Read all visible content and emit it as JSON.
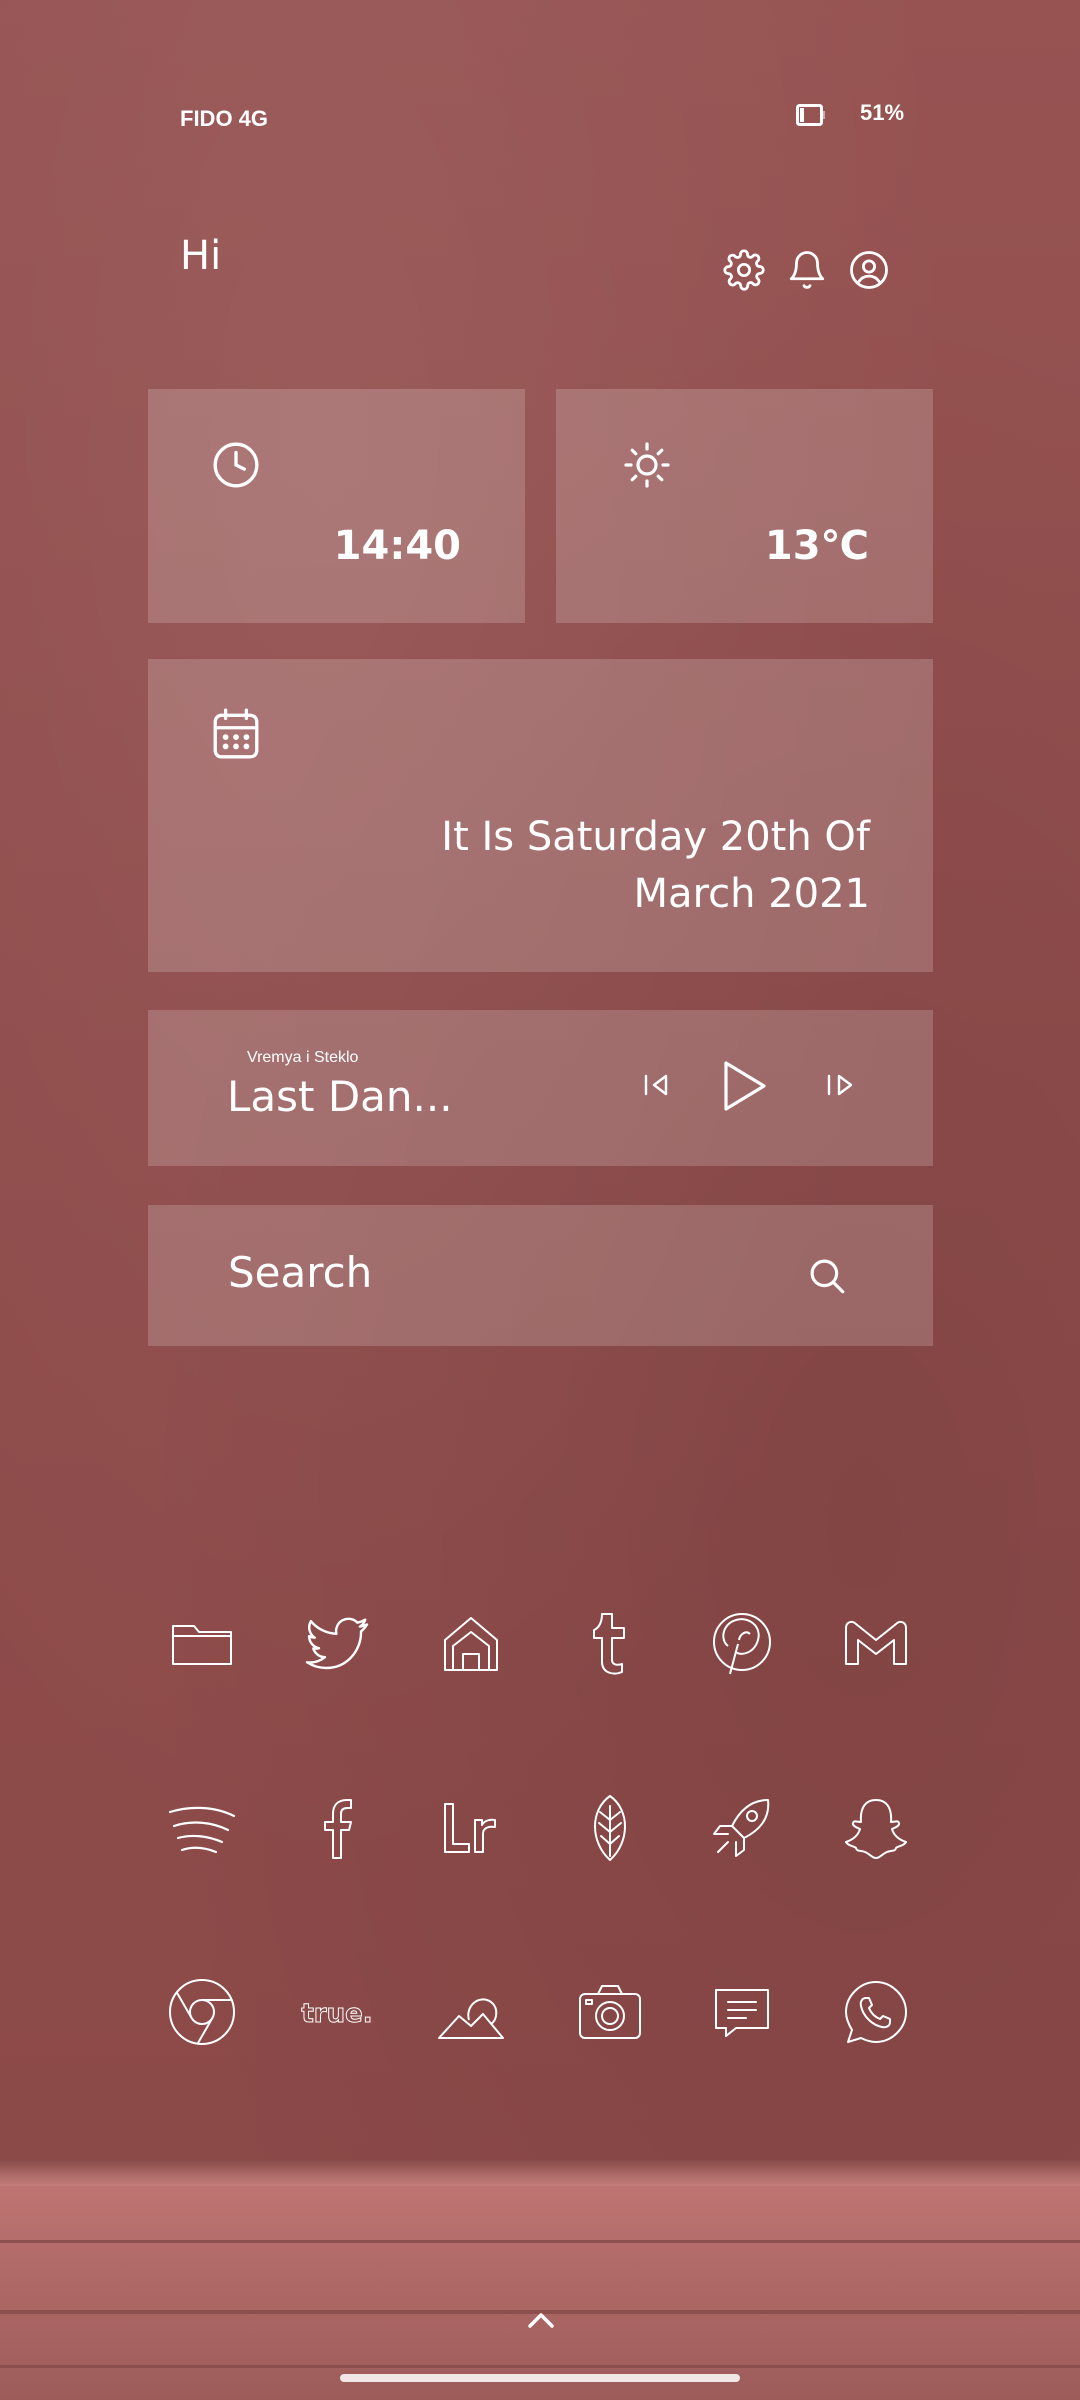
{
  "status_bar": {
    "carrier": "FIDO 4G",
    "battery_percent": "51%"
  },
  "header": {
    "greeting": "Hi",
    "icons": [
      "gear-icon",
      "bell-icon",
      "user-circle-icon"
    ]
  },
  "widgets": {
    "clock": {
      "icon": "clock-icon",
      "time": "14:40"
    },
    "weather": {
      "icon": "sun-icon",
      "temperature": "13℃"
    },
    "date": {
      "icon": "calendar-icon",
      "line1": "It Is Saturday 20th Of",
      "line2": "March 2021"
    },
    "music": {
      "artist": "Vremya i Steklo",
      "track": "Last Dan...",
      "controls": [
        "previous-icon",
        "play-icon",
        "next-icon"
      ]
    },
    "search": {
      "label": "Search",
      "icon": "search-icon"
    }
  },
  "app_rows": [
    [
      "folder-icon",
      "twitter-icon",
      "home-icon",
      "tumblr-icon",
      "pinterest-icon",
      "gmail-icon"
    ],
    [
      "spotify-icon",
      "facebook-icon",
      "lightroom-icon",
      "leaf-icon",
      "rocket-icon",
      "snapchat-icon"
    ],
    [
      "chrome-icon",
      "true-icon",
      "gallery-icon",
      "camera-icon",
      "messages-icon",
      "whatsapp-icon"
    ]
  ],
  "true_label": "true.",
  "colors": {
    "background": "#8e4b4a",
    "card": "rgba(255,255,255,0.18)",
    "foreground": "#ffffff"
  }
}
